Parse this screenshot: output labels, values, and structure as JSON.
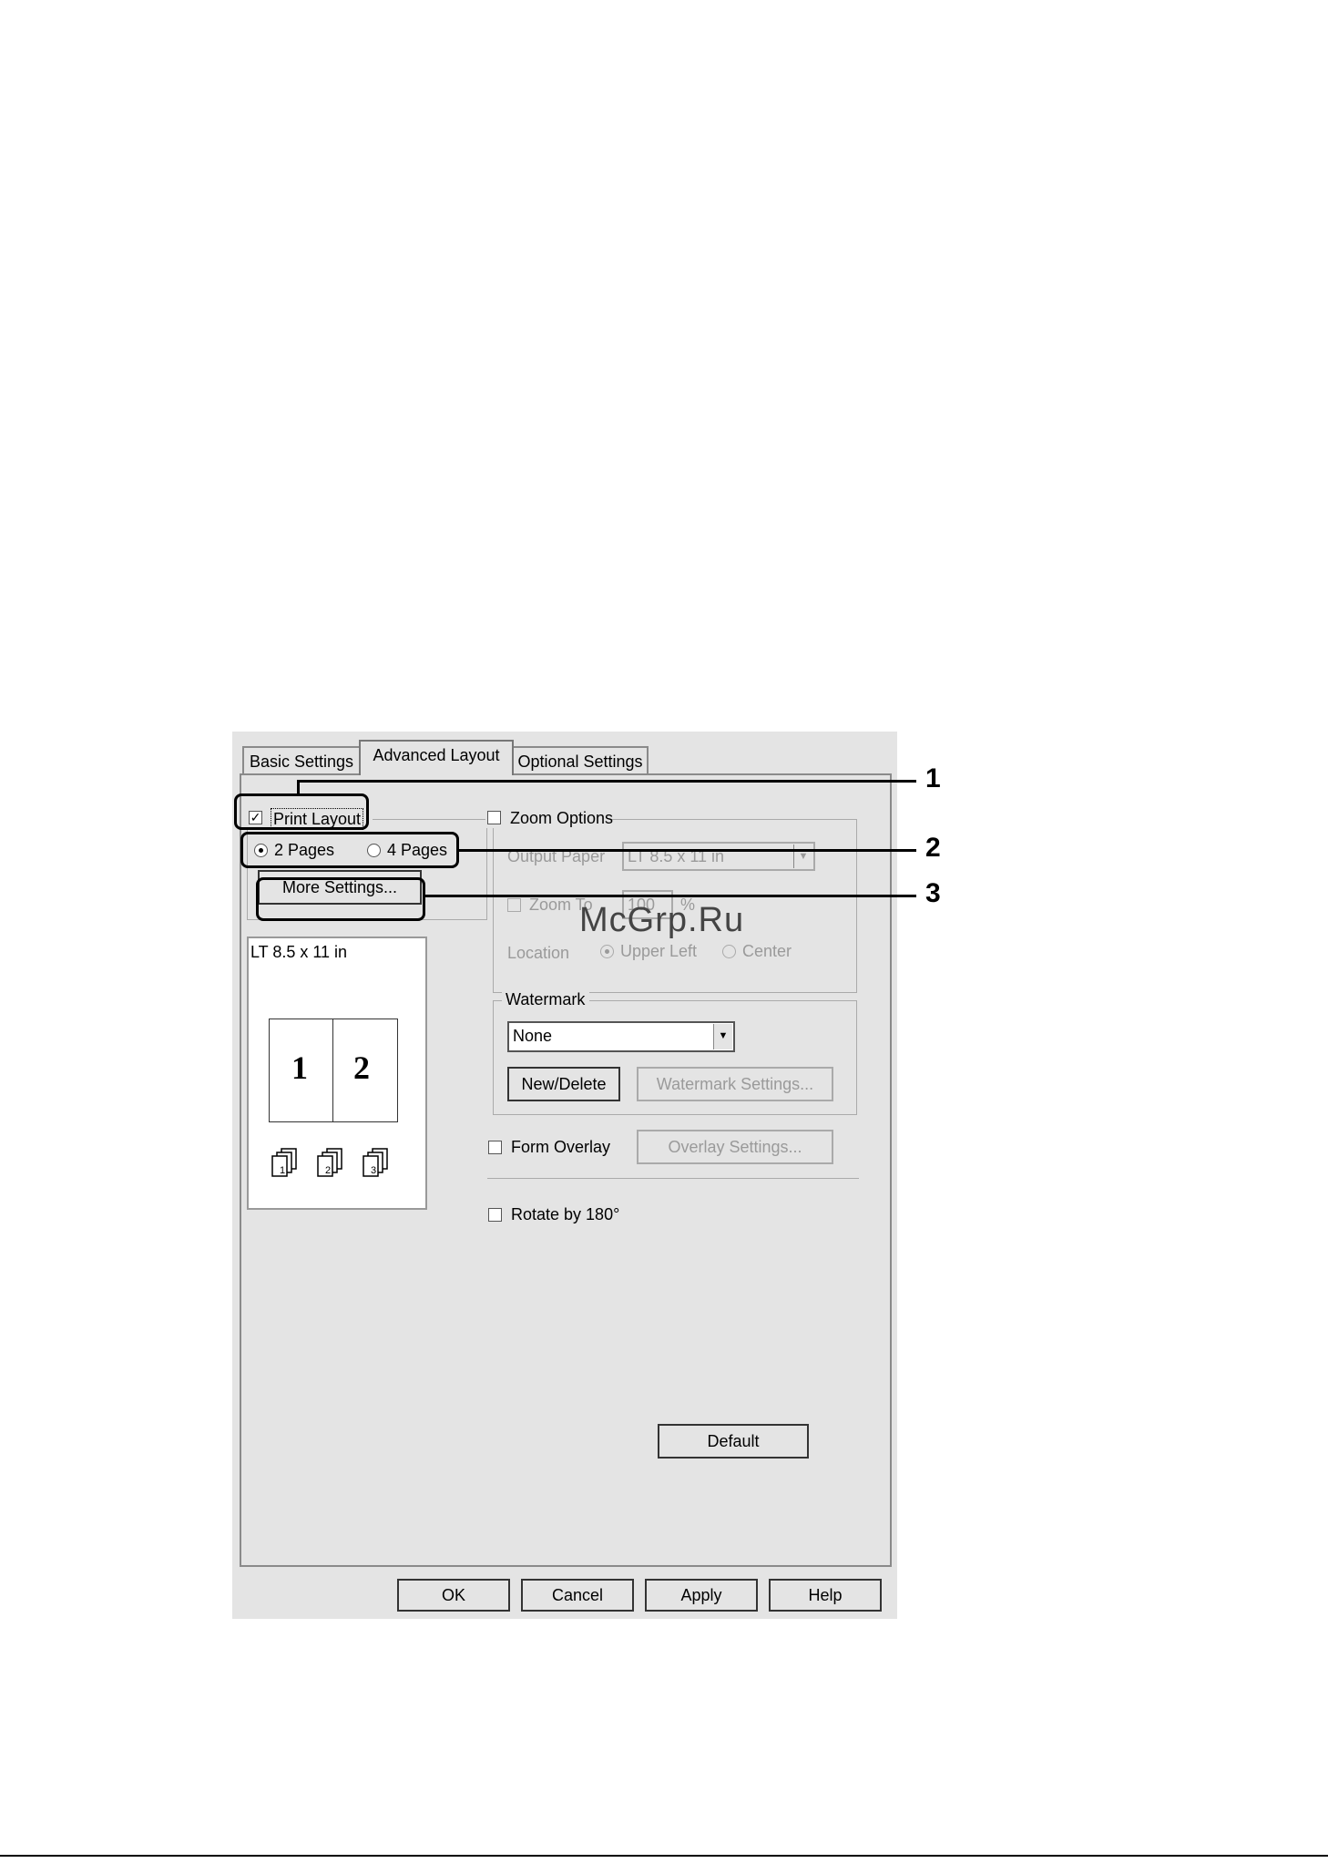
{
  "tabs": [
    "Basic Settings",
    "Advanced Layout",
    "Optional Settings"
  ],
  "print_layout": {
    "label": "Print Layout",
    "checked": true
  },
  "pages": {
    "option1": "2 Pages",
    "option2": "4 Pages",
    "selected": "2 Pages"
  },
  "more_settings": "More Settings...",
  "preview": {
    "paper_label": "LT 8.5 x 11 in",
    "page1": "1",
    "page2": "2",
    "icon_nums": [
      "1",
      "2",
      "3"
    ]
  },
  "zoom": {
    "label": "Zoom Options",
    "output_paper_label": "Output Paper",
    "output_paper_value": "LT 8.5 x 11 in",
    "zoom_to_label": "Zoom To",
    "zoom_value": "100",
    "percent": "%",
    "location_label": "Location",
    "upper_left": "Upper Left",
    "center": "Center"
  },
  "watermark": {
    "label": "Watermark",
    "value": "None",
    "new_delete": "New/Delete",
    "settings": "Watermark Settings..."
  },
  "form_overlay": {
    "label": "Form Overlay",
    "settings": "Overlay Settings..."
  },
  "rotate": {
    "label": "Rotate by 180°"
  },
  "default_button": "Default",
  "footer": {
    "ok": "OK",
    "cancel": "Cancel",
    "apply": "Apply",
    "help": "Help"
  },
  "watermark_text": "McGrp.Ru",
  "callouts": [
    "1",
    "2",
    "3"
  ]
}
